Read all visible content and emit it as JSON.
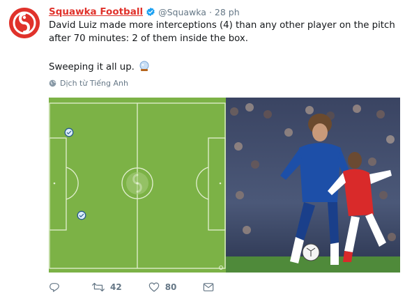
{
  "tweet": {
    "author_name": "Squawka Football",
    "handle": "@Squawka",
    "separator": "·",
    "time": "28 ph",
    "text_line1": "David Luiz made more interceptions (4) than any other player on the pitch",
    "text_line2": "after 70 minutes: 2 of them inside the box.",
    "text_para2": "Sweeping it all up.",
    "translate_label": "Dịch từ Tiếng Anh",
    "colors": {
      "brand": "#e0322b",
      "pitch": "#7cb246",
      "verified": "#1da1f2",
      "muted": "#657786"
    }
  },
  "media": {
    "pitch_icon": "interception-marker-icon",
    "photo_description_icons": [
      "player-photo"
    ]
  },
  "actions": {
    "reply_icon": "reply-icon",
    "retweet_icon": "retweet-icon",
    "retweet_count": "42",
    "like_icon": "heart-icon",
    "like_count": "80",
    "dm_icon": "mail-icon"
  }
}
